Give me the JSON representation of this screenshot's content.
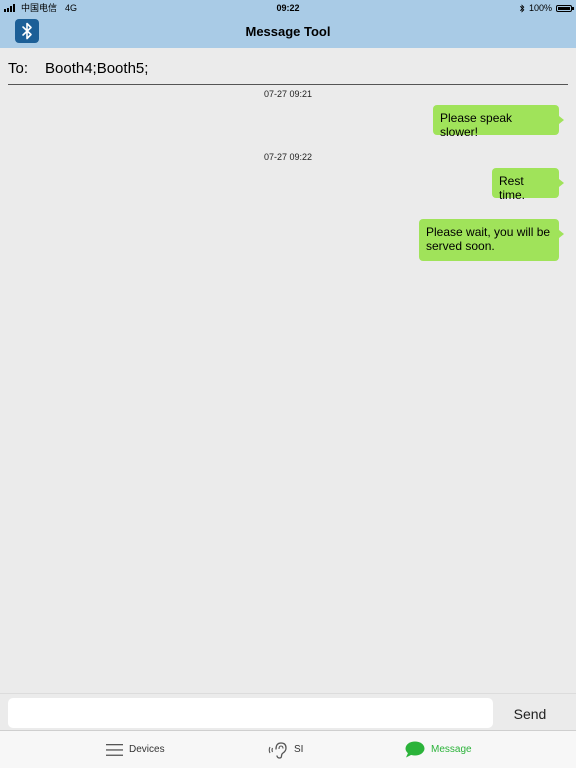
{
  "status_bar": {
    "carrier": "中国电信",
    "network": "4G",
    "time": "09:22",
    "battery": "100%"
  },
  "nav": {
    "title": "Message Tool",
    "left_icon": "bluetooth-icon"
  },
  "recipients": {
    "label": "To:",
    "value": "Booth4;Booth5;"
  },
  "messages": [
    {
      "timestamp": "07-27 09:21",
      "text": "Please speak slower!"
    },
    {
      "timestamp": "07-27 09:22",
      "text": "Rest time."
    },
    {
      "timestamp": "",
      "text": "Please wait, you will be served soon."
    }
  ],
  "composer": {
    "value": "",
    "placeholder": "",
    "send_label": "Send"
  },
  "tabs": [
    {
      "label": "Devices",
      "icon": "menu-lines-icon",
      "active": false
    },
    {
      "label": "SI",
      "icon": "ear-sound-icon",
      "active": false
    },
    {
      "label": "Message",
      "icon": "chat-bubble-icon",
      "active": true
    }
  ],
  "colors": {
    "header": "#a9cbe6",
    "bubble": "#a0e35a",
    "active_tab": "#2bb33a",
    "background": "#ebebeb"
  }
}
